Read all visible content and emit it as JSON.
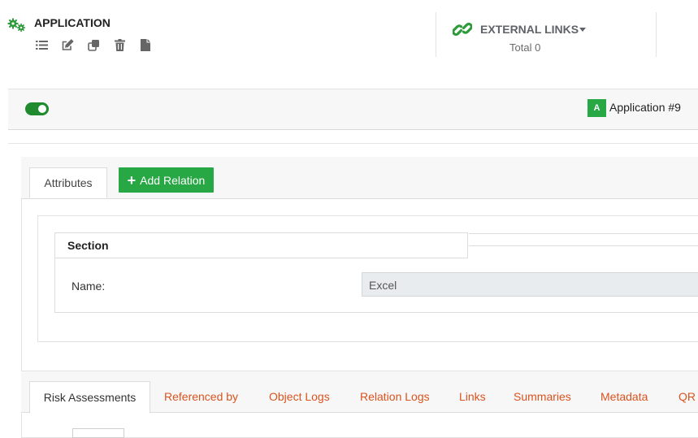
{
  "header": {
    "title": "APPLICATION",
    "toolbar_icons": [
      "list-icon",
      "edit-icon",
      "copy-icon",
      "trash-icon",
      "file-icon"
    ]
  },
  "external_links": {
    "title": "EXTERNAL LINKS",
    "total": "Total 0"
  },
  "status": {
    "toggle_on": true,
    "type_badge": "A",
    "object_name": "Application #9"
  },
  "attributes_card": {
    "tab_label": "Attributes",
    "add_relation_label": "Add Relation",
    "section_title": "Section",
    "fields": [
      {
        "label": "Name:",
        "value": "Excel"
      }
    ]
  },
  "bottom_tabs": [
    "Risk Assessments",
    "Referenced by",
    "Object Logs",
    "Relation Logs",
    "Links",
    "Summaries",
    "Metadata",
    "QR C"
  ],
  "colors": {
    "accent_green": "#28a745",
    "tab_link_orange": "#d9531e"
  }
}
